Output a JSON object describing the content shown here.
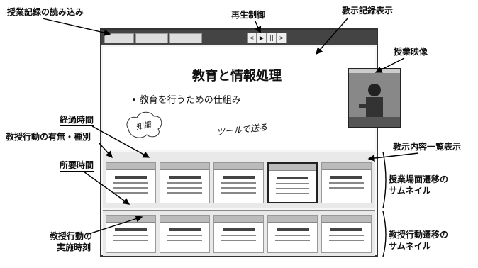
{
  "labels": {
    "load_record": "授業記録の読み込み",
    "playback": "再生制御",
    "record_display": "教示記録表示",
    "lecture_video": "授業映像",
    "elapsed_time": "経過時間",
    "teaching_action_type": "教授行動の有無・種別",
    "required_time": "所要時間",
    "teaching_action_time_l1": "教授行動の",
    "teaching_action_time_l2": "実施時刻",
    "content_list": "教示内容一覧表示",
    "scene_thumb_l1": "授業場面遷移の",
    "scene_thumb_l2": "サムネイル",
    "action_thumb_l1": "教授行動遷移の",
    "action_thumb_l2": "サムネイル"
  },
  "slide": {
    "title": "教育と情報処理",
    "bullet": "• 教育を行うための仕組み",
    "handwriting_1": "知識",
    "handwriting_2": "ツールで送る"
  },
  "controls": [
    "<",
    "▶",
    "||",
    ">"
  ],
  "icons": [
    "play-icon",
    "pause-icon",
    "prev-icon",
    "next-icon"
  ]
}
